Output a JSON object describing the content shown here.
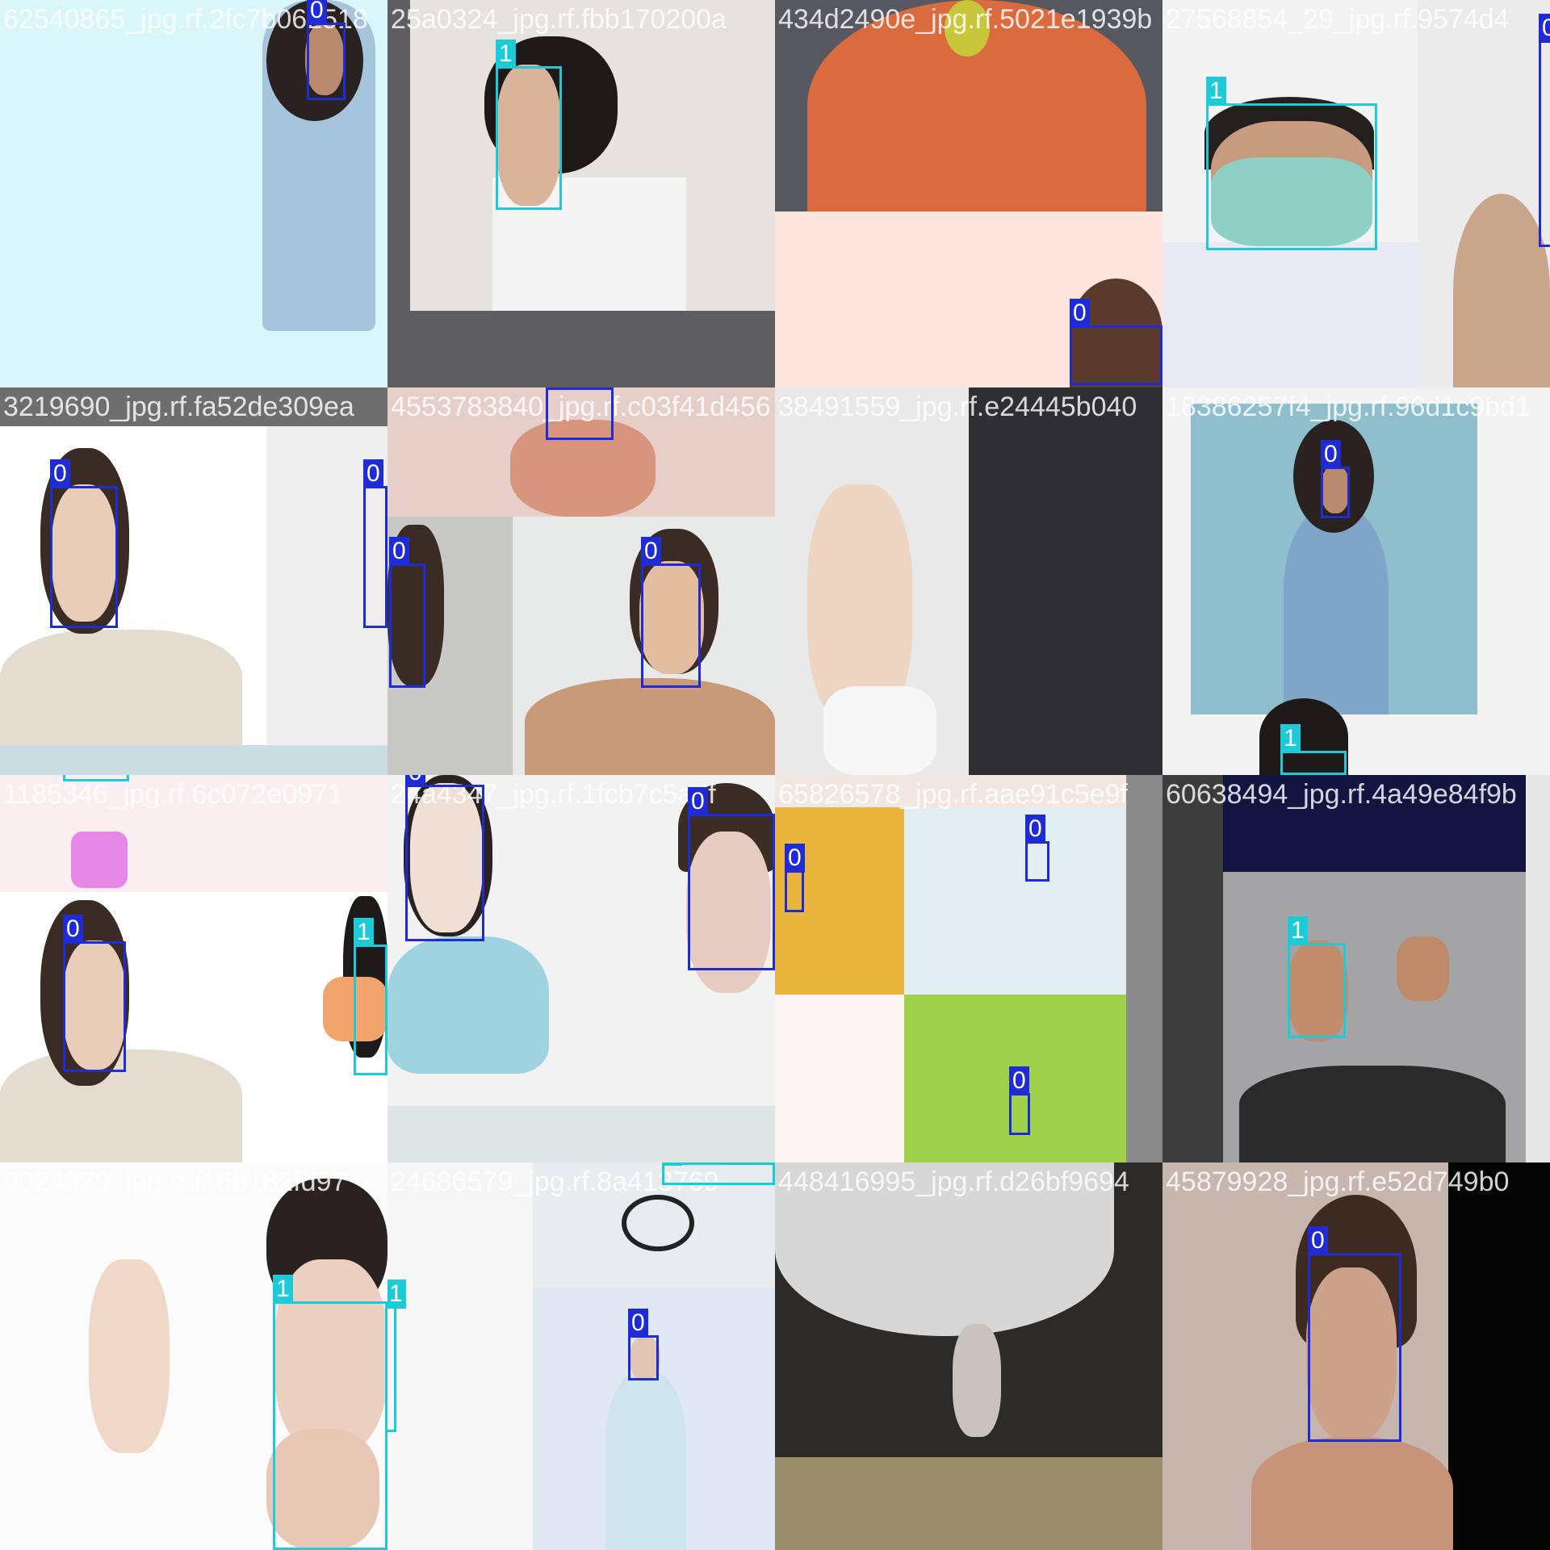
{
  "colors": {
    "class_0": "#1f2bd6",
    "class_1": "#1ccad8",
    "tag_text": "#ffffff"
  },
  "tiles": [
    {
      "filename": "62540865_jpg.rf.2fc7b062518"
    },
    {
      "filename": "25a0324_jpg.rf.fbb170200a"
    },
    {
      "filename": "434d2490e_jpg.rf.5021e1939b"
    },
    {
      "filename": "27568854_29_jpg.rf.9574d4"
    },
    {
      "filename": "3219690_jpg.rf.fa52de309ea"
    },
    {
      "filename": "4553783840_jpg.rf.c03f41d456"
    },
    {
      "filename": "38491559_jpg.rf.e24445b040"
    },
    {
      "filename": "18386257f4_jpg.rf.96d1c9bd1"
    },
    {
      "filename": "1185346_jpg.rf.6c072e0971"
    },
    {
      "filename": "24a4347_jpg.rf.1fcb7c5adf"
    },
    {
      "filename": "65826578_jpg.rf.aae91c5e9f"
    },
    {
      "filename": "60638494_jpg.rf.4a49e84f9b"
    },
    {
      "filename": "9024339_jpg.rf.f16b182fd97"
    },
    {
      "filename": "24686579_jpg.rf.8a413769"
    },
    {
      "filename": "448416995_jpg.rf.d26bf9694"
    },
    {
      "filename": "45879928_jpg.rf.e52d749b0"
    }
  ],
  "boxes": [
    {
      "cls": "0"
    },
    {
      "cls": "1"
    },
    {
      "cls": "0"
    },
    {
      "cls": "1"
    },
    {
      "cls": "0"
    },
    {
      "cls": "0"
    },
    {
      "cls": "0"
    },
    {
      "cls": "0"
    },
    {
      "cls": "0"
    },
    {
      "cls": "0"
    },
    {
      "cls": "0"
    },
    {
      "cls": "1"
    },
    {
      "cls": "1"
    },
    {
      "cls": "0"
    },
    {
      "cls": "1"
    },
    {
      "cls": "0"
    },
    {
      "cls": "0"
    },
    {
      "cls": "0"
    },
    {
      "cls": "0"
    },
    {
      "cls": "0"
    },
    {
      "cls": "1"
    },
    {
      "cls": "1"
    },
    {
      "cls": "1"
    },
    {
      "cls": "1"
    },
    {
      "cls": "0"
    },
    {
      "cls": "0"
    }
  ]
}
